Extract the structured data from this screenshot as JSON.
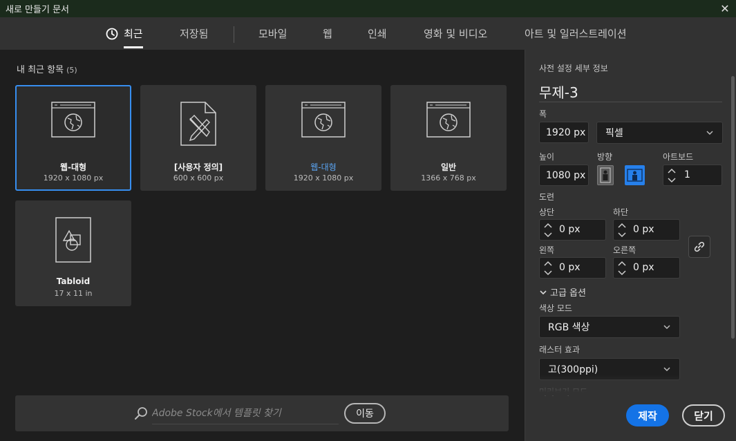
{
  "window": {
    "title": "새로 만들기 문서",
    "close_glyph": "✕"
  },
  "tabs": [
    {
      "label": "최근",
      "icon": "clock-icon",
      "active": true
    },
    {
      "label": "저장됨"
    },
    {
      "label": "모바일"
    },
    {
      "label": "웹"
    },
    {
      "label": "인쇄"
    },
    {
      "label": "영화 및 비디오"
    },
    {
      "label": "아트 및 일러스트레이션"
    }
  ],
  "recent": {
    "title": "내 최근 항목",
    "count": "(5)",
    "items": [
      {
        "name": "웹-대형",
        "size": "1920 x 1080 px",
        "icon": "web-document-icon",
        "selected": true
      },
      {
        "name": "[사용자 정의]",
        "size": "600 x 600 px",
        "icon": "custom-document-icon"
      },
      {
        "name": "웹-대형",
        "size": "1920 x 1080 px",
        "icon": "web-document-icon",
        "name_color": "#5aa3f0"
      },
      {
        "name": "일반",
        "size": "1366 x 768 px",
        "icon": "web-document-icon"
      },
      {
        "name": "Tabloid",
        "size": "17 x 11 in",
        "icon": "print-document-icon"
      }
    ]
  },
  "stock": {
    "placeholder": "Adobe Stock에서 템플릿 찾기",
    "go_label": "이동"
  },
  "preset": {
    "header": "사전 설정 세부 정보",
    "doc_name": "무제-3",
    "width_label": "폭",
    "width_value": "1920 px",
    "unit_value": "픽셀",
    "height_label": "높이",
    "height_value": "1080 px",
    "orientation_label": "방향",
    "orientation_options": [
      "세로",
      "가로"
    ],
    "orientation_selected": "가로",
    "artboards_label": "아트보드",
    "artboards_value": "1",
    "bleed_label": "도련",
    "bleed_top_label": "상단",
    "bleed_top_value": "0 px",
    "bleed_bottom_label": "하단",
    "bleed_bottom_value": "0 px",
    "bleed_left_label": "왼쪽",
    "bleed_left_value": "0 px",
    "bleed_right_label": "오른쪽",
    "bleed_right_value": "0 px",
    "advanced_label": "고급 옵션",
    "color_mode_label": "색상 모드",
    "color_mode_value": "RGB 색상",
    "raster_label": "래스터 효과",
    "raster_value": "고(300ppi)",
    "preview_label": "미리보기 모드"
  },
  "actions": {
    "create_label": "제작",
    "close_label": "닫기"
  },
  "colors": {
    "accent": "#1473e6",
    "selection": "#378ef0",
    "panel": "#323232",
    "background": "#1e1e1e",
    "titlebar": "#1b2b1c"
  }
}
